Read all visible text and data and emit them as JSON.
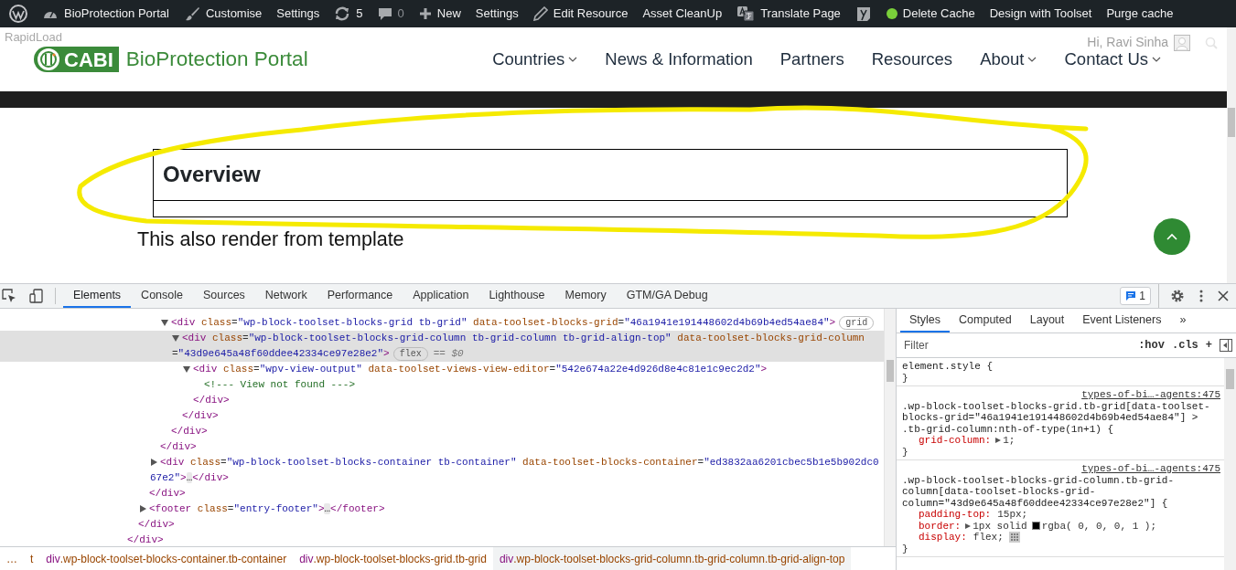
{
  "admin_bar": {
    "items": [
      {
        "label": "BioProtection Portal",
        "muted": false
      },
      {
        "label": "Customise",
        "muted": false
      },
      {
        "label": "Settings",
        "muted": false
      },
      {
        "label": "5",
        "muted": false
      },
      {
        "label": "0",
        "muted": true
      },
      {
        "label": "New",
        "muted": false
      },
      {
        "label": "Settings",
        "muted": false
      },
      {
        "label": "Edit Resource",
        "muted": false
      },
      {
        "label": "Asset CleanUp",
        "muted": false
      },
      {
        "label": "Translate Page",
        "muted": false
      },
      {
        "label": "Delete Cache",
        "muted": false
      },
      {
        "label": "Design with Toolset",
        "muted": false
      },
      {
        "label": "Purge cache",
        "muted": false
      }
    ]
  },
  "site": {
    "overlay_label": "RapidLoad",
    "logo_mark": "CABI",
    "logo_name": "BioProtection Portal",
    "greeting": "Hi, Ravi Sinha",
    "nav": [
      {
        "label": "Countries",
        "has_menu": true
      },
      {
        "label": "News & Information",
        "has_menu": false
      },
      {
        "label": "Partners",
        "has_menu": false
      },
      {
        "label": "Resources",
        "has_menu": false
      },
      {
        "label": "About",
        "has_menu": true
      },
      {
        "label": "Contact Us",
        "has_menu": true
      }
    ]
  },
  "content": {
    "heading": "Overview",
    "text": "This also render from template"
  },
  "devtools": {
    "tabs": [
      {
        "label": "Elements",
        "selected": true
      },
      {
        "label": "Console",
        "selected": false
      },
      {
        "label": "Sources",
        "selected": false
      },
      {
        "label": "Network",
        "selected": false
      },
      {
        "label": "Performance",
        "selected": false
      },
      {
        "label": "Application",
        "selected": false
      },
      {
        "label": "Lighthouse",
        "selected": false
      },
      {
        "label": "Memory",
        "selected": false
      },
      {
        "label": "GTM/GA Debug",
        "selected": false
      }
    ],
    "issues_count": "1",
    "elements": {
      "selected_suffix": "== $0",
      "nodes": [
        {
          "kind": "element",
          "selected": false,
          "close": "</div>",
          "children": [
            {
              "kind": "element",
              "selected": false,
              "close": "</div>",
              "children": [
                {
                  "kind": "element",
                  "selected": false,
                  "close": "</div>",
                  "children": [
                    {
                      "kind": "element",
                      "selected": false,
                      "close": "</div>",
                      "children": [
                        {
                          "kind": "element",
                          "open": "<div class=\"wp-block-toolset-blocks-grid tb-grid\" data-toolset-blocks-grid=\"46a1941e191448602d4b69b4ed54ae84\">",
                          "badge": "grid",
                          "expanded": true,
                          "selected": false,
                          "close": "</div>",
                          "children": [
                            {
                              "kind": "element",
                              "open": "<div class=\"wp-block-toolset-blocks-grid-column tb-grid-column tb-grid-align-top\" data-toolset-blocks-grid-column=\"43d9e645a48f60ddee42334ce97e28e2\">",
                              "badge": "flex",
                              "expanded": true,
                              "selected": true,
                              "close": "</div>",
                              "children": [
                                {
                                  "kind": "element",
                                  "open": "<div class=\"wpv-view-output\" data-toolset-views-view-editor=\"542e674a22e4d926d8e4c81e1c9ec2d2\">",
                                  "expanded": true,
                                  "selected": false,
                                  "close": "</div>",
                                  "children": [
                                    {
                                      "kind": "comment",
                                      "text": "<!--- View not found --->",
                                      "selected": false
                                    }
                                  ]
                                }
                              ]
                            }
                          ]
                        }
                      ]
                    },
                    {
                      "kind": "element",
                      "open": "<div class=\"wp-block-toolset-blocks-container tb-container\" data-toolset-blocks-container=\"ed3832aa6201cbec5b1e5b902dc067e2\">…</div>",
                      "expanded": false,
                      "selected": false
                    }
                  ]
                },
                {
                  "kind": "element",
                  "open": "<footer class=\"entry-footer\">…</footer>",
                  "expanded": false,
                  "selected": false
                }
              ]
            }
          ]
        }
      ]
    },
    "breadcrumb": {
      "overflow": "…",
      "items": [
        {
          "rest": "t",
          "selected": false
        },
        {
          "tag": "div",
          "rest": ".wp-block-toolset-blocks-container.tb-container",
          "selected": false
        },
        {
          "tag": "div",
          "rest": ".wp-block-toolset-blocks-grid.tb-grid",
          "selected": false
        },
        {
          "tag": "div",
          "rest": ".wp-block-toolset-blocks-grid-column.tb-grid-column.tb-grid-align-top",
          "selected": true
        }
      ]
    },
    "styles": {
      "tabs": [
        {
          "label": "Styles",
          "selected": true
        },
        {
          "label": "Computed",
          "selected": false
        },
        {
          "label": "Layout",
          "selected": false
        },
        {
          "label": "Event Listeners",
          "selected": false
        }
      ],
      "more": "»",
      "filter": {
        "placeholder": "Filter"
      },
      "hov": ":hov",
      "cls": ".cls",
      "new_rule": "+",
      "rules": [
        {
          "selector": "element.style",
          "open": "{",
          "close": "}"
        },
        {
          "selector": ".wp-block-toolset-blocks-grid.tb-grid[data-toolset-blocks-grid=\"46a1941e191448602d4b69b4ed54ae84\"] > .tb-grid-column:nth-of-type(1n+1)",
          "open": "{",
          "source": "types-of-bi…-agents:475",
          "close": "}",
          "declarations": [
            {
              "name": "grid-column:",
              "value": "1;",
              "expandable": true
            }
          ]
        },
        {
          "selector": ".wp-block-toolset-blocks-grid-column.tb-grid-column[data-toolset-blocks-grid-column=\"43d9e645a48f60ddee42334ce97e28e2\"]",
          "open": "{",
          "source": "types-of-bi…-agents:475",
          "close": "}",
          "declarations": [
            {
              "name": "padding-top:",
              "value": "15px;",
              "expandable": false
            },
            {
              "name": "border:",
              "value": "1px solid",
              "expandable": true,
              "color": "#000000",
              "color_text": "rgba( 0, 0, 0, 1 );"
            },
            {
              "name": "display:",
              "value": "flex;",
              "expandable": false,
              "flex_editor": true
            }
          ]
        }
      ]
    }
  }
}
